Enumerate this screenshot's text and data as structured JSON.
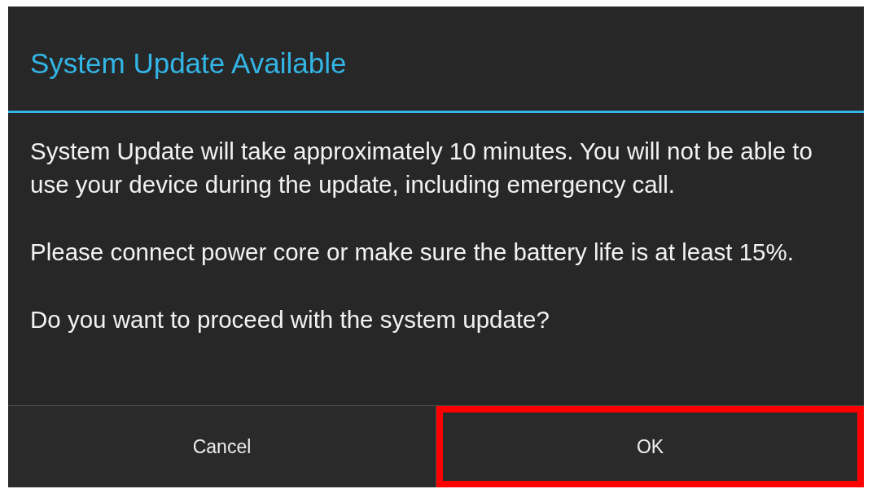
{
  "dialog": {
    "title": "System Update Available",
    "paragraphs": [
      "System Update will take approximately 10 minutes. You will not be able to use your device during the update, including emergency call.",
      "Please connect power core or make sure the battery life is at least 15%.",
      "Do you want to proceed with the system update?"
    ],
    "buttons": [
      {
        "label": "Cancel",
        "highlighted": false
      },
      {
        "label": "OK",
        "highlighted": true
      }
    ]
  }
}
